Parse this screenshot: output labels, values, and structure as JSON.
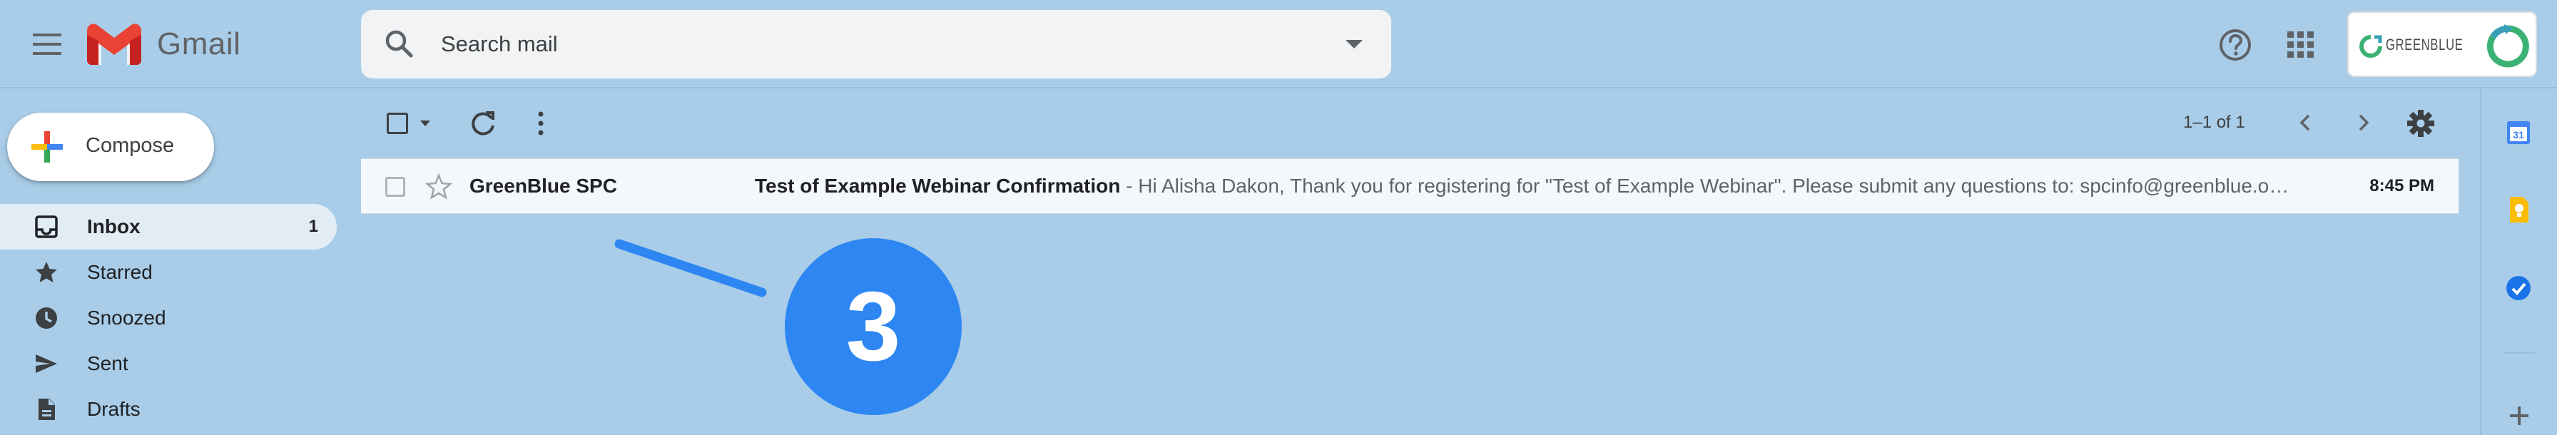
{
  "app": {
    "name": "Gmail"
  },
  "search": {
    "placeholder": "Search mail"
  },
  "brand": {
    "name": "GREENBLUE"
  },
  "compose": {
    "label": "Compose"
  },
  "sidebar": {
    "items": [
      {
        "label": "Inbox",
        "count": "1",
        "icon": "inbox-icon"
      },
      {
        "label": "Starred",
        "icon": "star-icon"
      },
      {
        "label": "Snoozed",
        "icon": "clock-icon"
      },
      {
        "label": "Sent",
        "icon": "send-icon"
      },
      {
        "label": "Drafts",
        "icon": "draft-icon"
      }
    ]
  },
  "toolbar": {
    "range": "1–1 of 1"
  },
  "emails": [
    {
      "sender": "GreenBlue SPC",
      "subject": "Test of Example Webinar Confirmation",
      "separator": " - ",
      "snippet": "Hi Alisha Dakon, Thank you for registering for \"Test of Example Webinar\". Please submit any questions to: spcinfo@greenblue.o…",
      "time": "8:45 PM"
    }
  ],
  "annotation": {
    "step": "3"
  },
  "colors": {
    "background": "#a9cde8",
    "accent": "#2d86f2",
    "brand_green": "#3bb273",
    "brand_teal": "#3a9fb8"
  },
  "side_panel": {
    "calendar_day": "31",
    "icons": [
      "calendar-icon",
      "keep-icon",
      "tasks-icon",
      "add-icon"
    ]
  }
}
